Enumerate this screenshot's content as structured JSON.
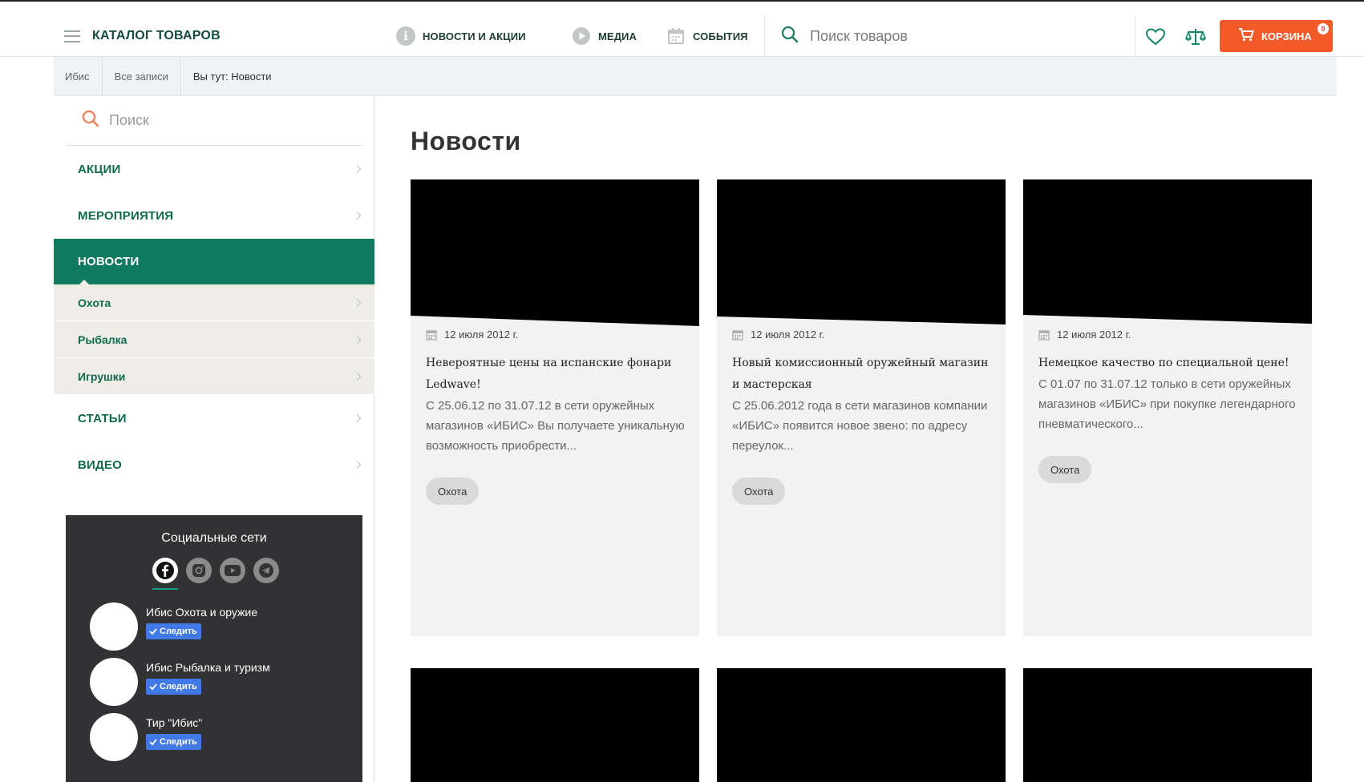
{
  "header": {
    "catalog_label": "КАТАЛОГ ТОВАРОВ",
    "nav": [
      {
        "label": "НОВОСТИ И АКЦИИ",
        "icon": "info-icon"
      },
      {
        "label": "МЕДИА",
        "icon": "play-icon"
      },
      {
        "label": "СОБЫТИЯ",
        "icon": "calendar-icon"
      }
    ],
    "search_placeholder": "Поиск товаров",
    "cart_label": "КОРЗИНА",
    "cart_count": "0",
    "colors": {
      "accent": "#0f7a5e",
      "cart": "#f25a2a",
      "dark_panel": "#323134"
    }
  },
  "breadcrumb": [
    "Ибис",
    "Все записи",
    "Вы тут: Новости"
  ],
  "sidebar": {
    "search_placeholder": "Поиск",
    "menu": [
      {
        "label": "АКЦИИ"
      },
      {
        "label": "МЕРОПРИЯТИЯ"
      },
      {
        "label": "НОВОСТИ",
        "active": true
      },
      {
        "label": "СТАТЬИ"
      },
      {
        "label": "ВИДЕО"
      }
    ],
    "submenu": [
      "Охота",
      "Рыбалка",
      "Игрушки"
    ]
  },
  "social": {
    "title": "Социальные сети",
    "icons": [
      "facebook-icon",
      "instagram-icon",
      "youtube-icon",
      "telegram-icon"
    ],
    "groups": [
      {
        "name": "Ибис Охота и оружие",
        "follow": "Следить"
      },
      {
        "name": "Ибис Рыбалка и туризм",
        "follow": "Следить"
      },
      {
        "name": "Тир \"Ибис\"",
        "follow": "Следить"
      }
    ]
  },
  "main": {
    "title": "Новости",
    "cards": [
      {
        "date": "12 июля 2012 г.",
        "title": "Невероятные цены на испанские фонари Ledwave!",
        "text": "С 25.06.12 по 31.07.12  в сети оружейных магазинов «ИБИС» Вы получаете уникальную возможность приобрести...",
        "tag": "Охота"
      },
      {
        "date": "12 июля 2012 г.",
        "title": "Новый комиссионный оружейный магазин и мастерская",
        "text": "С 25.06.2012 года в сети магазинов компании «ИБИС» появится новое звено: по адресу переулок...",
        "tag": "Охота"
      },
      {
        "date": "12 июля 2012 г.",
        "title": "Немецкое качество по специальной цене!",
        "text": "С 01.07 по 31.07.12 только в сети оружейных магазинов «ИБИС» при покупке легендарного пневматического...",
        "tag": "Охота"
      }
    ]
  }
}
